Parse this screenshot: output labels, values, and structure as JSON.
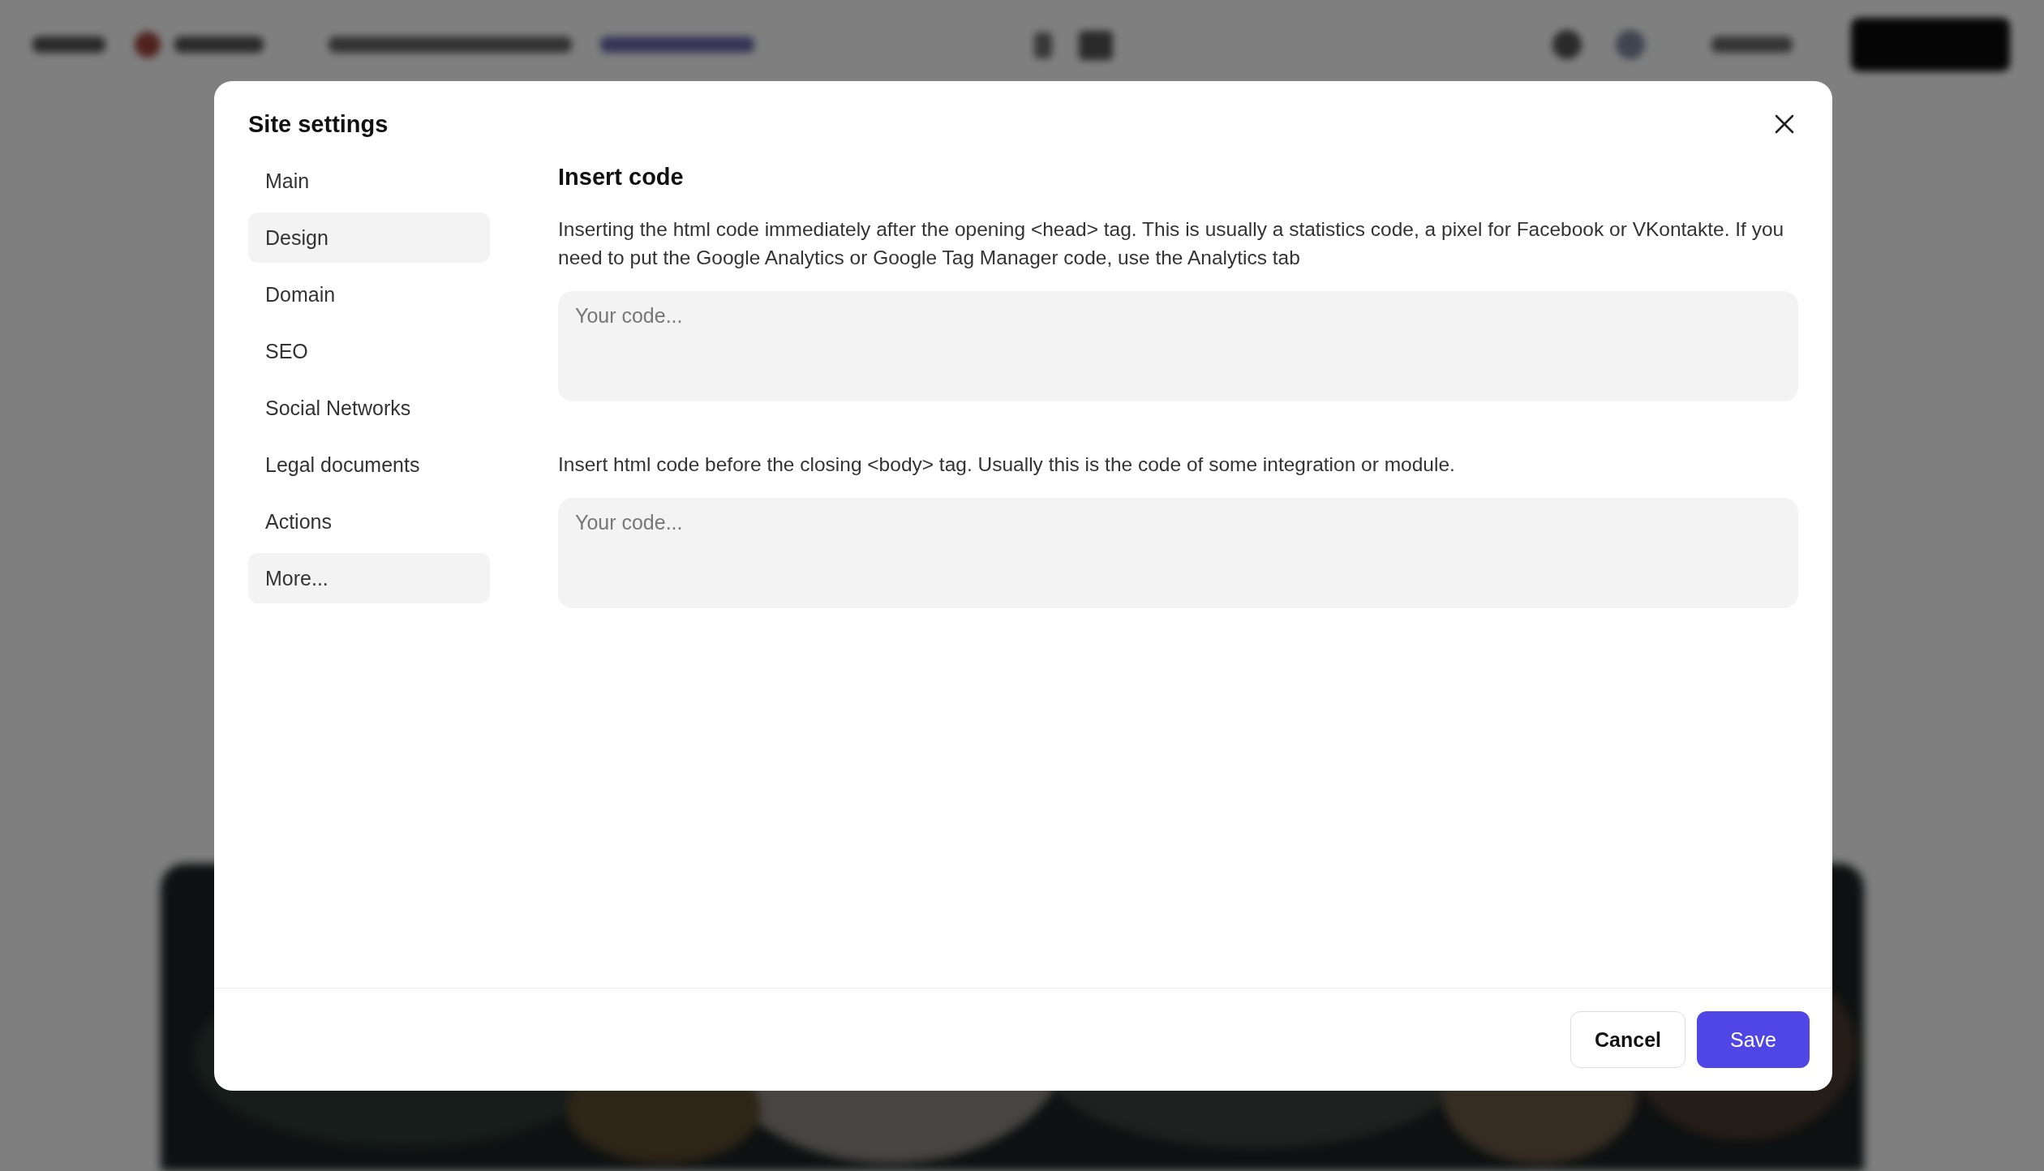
{
  "dialog": {
    "title": "Site settings",
    "menu": [
      {
        "label": "Main",
        "selected": false
      },
      {
        "label": "Design",
        "selected": true
      },
      {
        "label": "Domain",
        "selected": false
      },
      {
        "label": "SEO",
        "selected": false
      },
      {
        "label": "Social Networks",
        "selected": false
      },
      {
        "label": "Legal documents",
        "selected": false
      },
      {
        "label": "Actions",
        "selected": false
      },
      {
        "label": "More...",
        "selected": true
      }
    ],
    "section_title": "Insert code",
    "fields": [
      {
        "description": "Inserting the html code immediately after the opening <head> tag. This is usually a statistics code, a pixel for Facebook or VKontakte. If you need to put the Google Analytics or Google Tag Manager code, use the Analytics tab",
        "placeholder": "Your code..."
      },
      {
        "description": "Insert html code before the closing <body> tag. Usually this is the code of some integration or module.",
        "placeholder": "Your code..."
      }
    ],
    "buttons": [
      {
        "label": "Cancel",
        "kind": "secondary"
      },
      {
        "label": "Save",
        "kind": "primary"
      }
    ]
  }
}
